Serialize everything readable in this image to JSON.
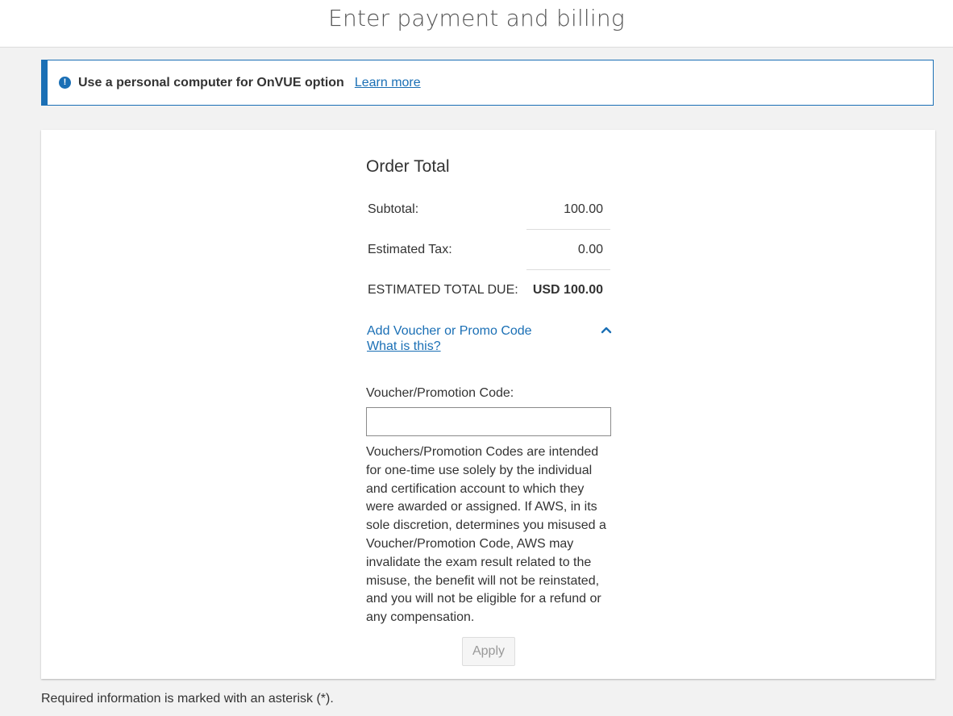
{
  "header": {
    "title": "Enter payment and billing"
  },
  "alert": {
    "icon": "exclamation-circle-icon",
    "message": "Use a personal computer for OnVUE option",
    "link_label": "Learn more"
  },
  "order": {
    "title": "Order Total",
    "rows": [
      {
        "label": "Subtotal:",
        "value": "100.00"
      },
      {
        "label": "Estimated Tax:",
        "value": "0.00"
      },
      {
        "label": "ESTIMATED TOTAL DUE:",
        "value": "USD 100.00"
      }
    ]
  },
  "voucher": {
    "toggle_label": "Add Voucher or Promo Code",
    "help_label": "What is this?",
    "toggle_icon": "chevron-up-icon",
    "field_label": "Voucher/Promotion Code:",
    "field_value": "",
    "field_placeholder": "",
    "disclaimer": "Vouchers/Promotion Codes are intended for one-time use solely by the individual and certification account to which they were awarded or assigned. If AWS, in its sole discretion, determines you misused a Voucher/Promotion Code, AWS may invalidate the exam result related to the misuse, the benefit will not be reinstated, and you will not be eligible for a refund or any compensation.",
    "apply_label": "Apply"
  },
  "footer": {
    "note": "Required information is marked with an asterisk (*)."
  },
  "colors": {
    "accent": "#1a6fb5",
    "text": "#333333",
    "background": "#f2f2f2"
  }
}
